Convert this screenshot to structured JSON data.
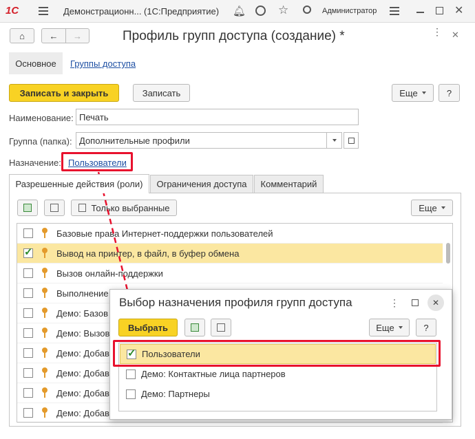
{
  "titlebar": {
    "app_title": "Демонстрационн...  (1С:Предприятие)",
    "user": "Администратор",
    "logo": "1С"
  },
  "form": {
    "title": "Профиль групп доступа (создание) *",
    "tabs_top": [
      "Основное",
      "Группы доступа"
    ],
    "save_close": "Записать и закрыть",
    "save": "Записать",
    "more": "Еще",
    "help": "?",
    "name_label": "Наименование:",
    "name_value": "Печать",
    "group_label": "Группа (папка):",
    "group_value": "Дополнительные профили",
    "purpose_label": "Назначение:",
    "purpose_link": "Пользователи"
  },
  "inner_tabs": [
    "Разрешенные действия (роли)",
    "Ограничения доступа",
    "Комментарий"
  ],
  "roles_toolbar": {
    "only_selected": "Только выбранные",
    "more": "Еще"
  },
  "roles": [
    {
      "label": "Базовые права Интернет-поддержки пользователей",
      "checked": false
    },
    {
      "label": "Вывод на принтер, в файл, в буфер обмена",
      "checked": true
    },
    {
      "label": "Вызов онлайн-поддержки",
      "checked": false
    },
    {
      "label": "Выполнение",
      "checked": false
    },
    {
      "label": "Демо: Базов",
      "checked": false
    },
    {
      "label": "Демо: Вызов",
      "checked": false
    },
    {
      "label": "Демо: Добав",
      "checked": false
    },
    {
      "label": "Демо: Добав",
      "checked": false
    },
    {
      "label": "Демо: Добав",
      "checked": false
    },
    {
      "label": "Демо: Добав",
      "checked": false
    }
  ],
  "dialog": {
    "title": "Выбор назначения профиля групп доступа",
    "select": "Выбрать",
    "more": "Еще",
    "help": "?",
    "items": [
      {
        "label": "Пользователи",
        "checked": true
      },
      {
        "label": "Демо: Контактные лица партнеров",
        "checked": false
      },
      {
        "label": "Демо: Партнеры",
        "checked": false
      }
    ]
  },
  "colors": {
    "accent": "#f8d224",
    "highlight": "#fbe7a1",
    "annotation": "#e8112d"
  }
}
